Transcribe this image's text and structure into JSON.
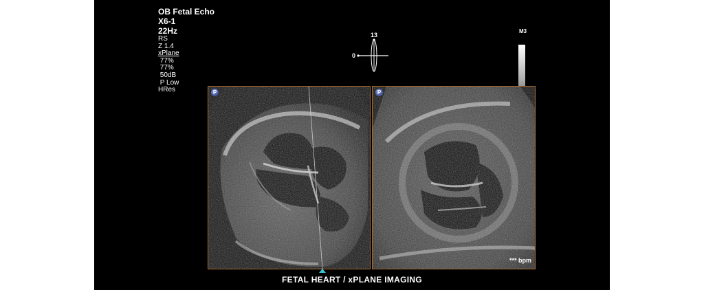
{
  "params": {
    "preset": "OB Fetal Echo",
    "probe": "X6-1",
    "frame_rate": "22Hz",
    "rs": "RS",
    "zoom": "Z 1.4",
    "mode": "xPlane",
    "gain1": " 77%",
    "gain2": " 77%",
    "dynamic_range": " 50dB",
    "power": " P Low",
    "resolution": "HRes"
  },
  "orientation": {
    "top_value": "13",
    "left_value": "0"
  },
  "grayscale": {
    "label": "M3"
  },
  "panels": {
    "left_badge": "P",
    "right_badge": "P"
  },
  "heart_rate": "*** bpm",
  "caption": "FETAL  HEART / xPLANE  IMAGING",
  "colors": {
    "panel_border": "#a86a2a",
    "marker": "#39c6d4",
    "badge": "#3b4fa0"
  }
}
